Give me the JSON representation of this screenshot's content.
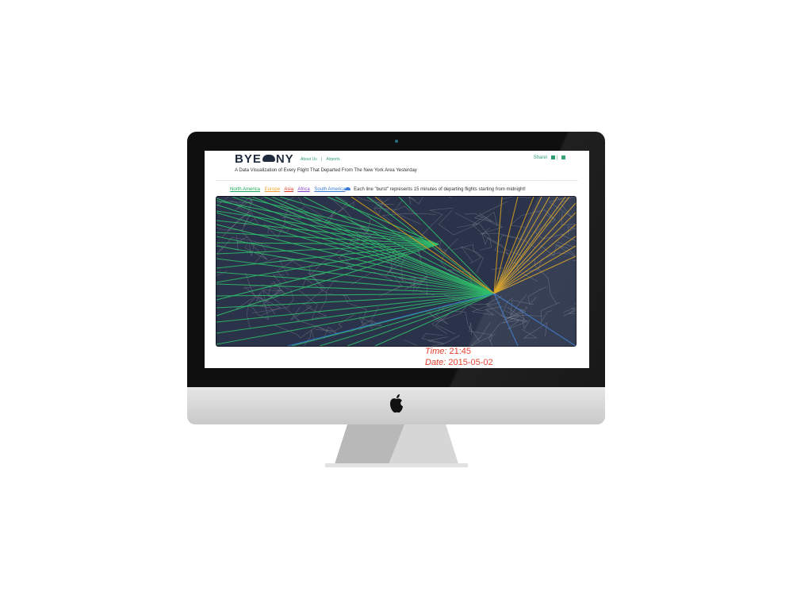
{
  "site": {
    "logo_left": "BYE",
    "logo_right": "NY",
    "nav": [
      "About Us",
      "|",
      "Airports"
    ],
    "share_label": "Share!",
    "share_sep": "|",
    "subtitle": "A Data Visualization of Every Flight That Departed From The New York Area Yesterday"
  },
  "legend": {
    "items": [
      {
        "label": "North America",
        "color": "#1fa85a"
      },
      {
        "label": "Europe",
        "color": "#f0a52a"
      },
      {
        "label": "Asia",
        "color": "#e0382b"
      },
      {
        "label": "Africa",
        "color": "#8a3fc0"
      },
      {
        "label": "South America",
        "color": "#3a7bd5"
      }
    ],
    "description": "Each line \"burst\" represents 15 minutes of departing flights starting from midnight!"
  },
  "readout": {
    "time_label": "Time:",
    "time_value": "21:45",
    "date_label": "Date:",
    "date_value": "2015-05-02"
  },
  "colors": {
    "map_bg": "#2a3349",
    "accent": "#2e9c6f",
    "readout": "#e23a2a"
  },
  "icons": [
    "cloud-icon",
    "facebook-icon",
    "share-icon",
    "apple-logo-icon"
  ]
}
